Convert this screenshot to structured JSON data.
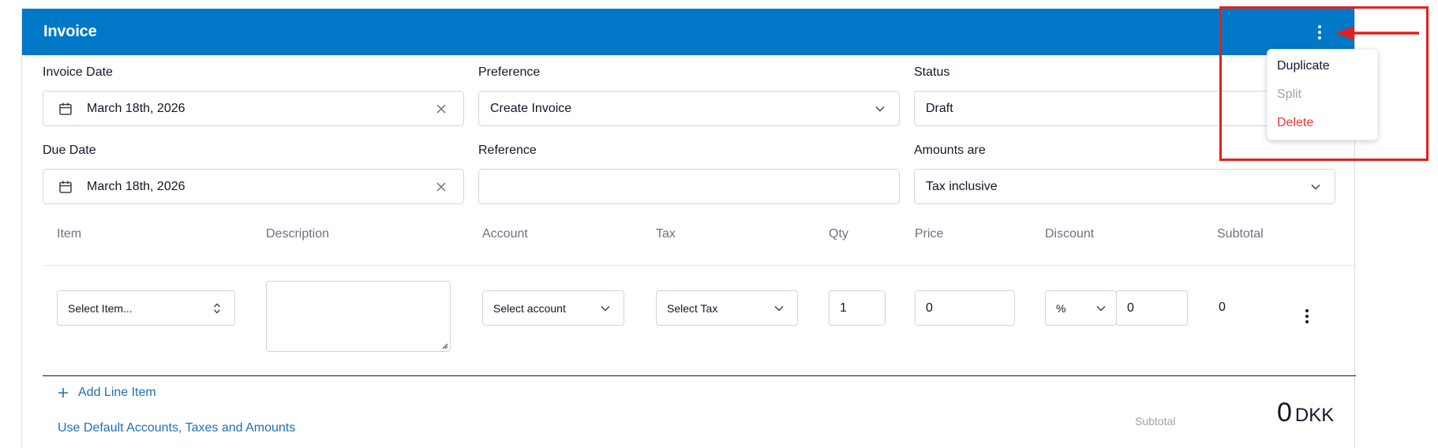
{
  "header": {
    "title": "Invoice"
  },
  "fields": {
    "invoice_date": {
      "label": "Invoice Date",
      "value": "March 18th, 2026"
    },
    "preference": {
      "label": "Preference",
      "value": "Create Invoice"
    },
    "status": {
      "label": "Status",
      "value": "Draft"
    },
    "due_date": {
      "label": "Due Date",
      "value": "March 18th, 2026"
    },
    "reference": {
      "label": "Reference",
      "value": ""
    },
    "amounts_are": {
      "label": "Amounts are",
      "value": "Tax inclusive"
    }
  },
  "table": {
    "columns": [
      "Item",
      "Description",
      "Account",
      "Tax",
      "Qty",
      "Price",
      "Discount",
      "Subtotal"
    ],
    "row": {
      "item_placeholder": "Select Item...",
      "description": "",
      "account_placeholder": "Select account",
      "tax_placeholder": "Select Tax",
      "qty": "1",
      "price": "0",
      "discount_type": "%",
      "discount_value": "0",
      "subtotal": "0"
    }
  },
  "actions": {
    "add_line_item": "Add Line Item",
    "use_defaults": "Use Default Accounts, Taxes and Amounts"
  },
  "totals": {
    "subtotal_label": "Subtotal",
    "subtotal_value": "0",
    "currency": "DKK"
  },
  "menu": {
    "items": [
      {
        "label": "Duplicate",
        "color": "#111827"
      },
      {
        "label": "Split",
        "color": "#9ca3af"
      },
      {
        "label": "Delete",
        "color": "#e53935"
      }
    ]
  },
  "colors": {
    "header_bg": "#0078c8",
    "link": "#1f6fb6",
    "annotation": "#e02020"
  }
}
